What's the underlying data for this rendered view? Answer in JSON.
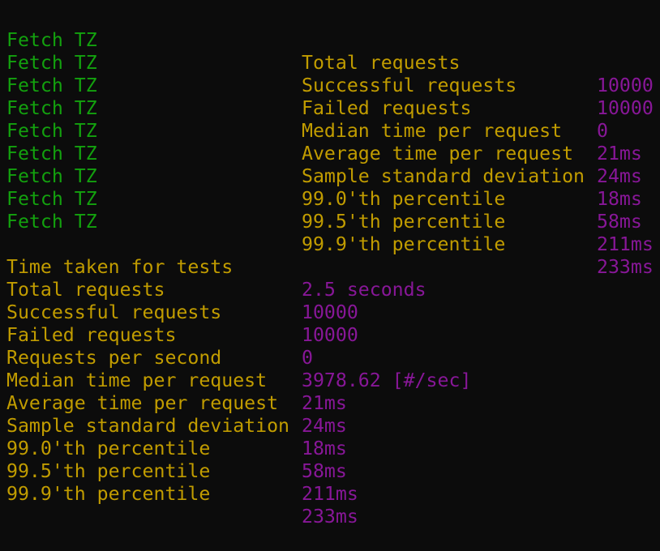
{
  "colors": {
    "background": "#0c0c0c",
    "name": "#13a10e",
    "label": "#c19c00",
    "value": "#881798"
  },
  "per_test": [
    {
      "name": "Fetch TZ",
      "label": "Total requests",
      "value": "10000"
    },
    {
      "name": "Fetch TZ",
      "label": "Successful requests",
      "value": "10000"
    },
    {
      "name": "Fetch TZ",
      "label": "Failed requests",
      "value": "0"
    },
    {
      "name": "Fetch TZ",
      "label": "Median time per request",
      "value": "21ms"
    },
    {
      "name": "Fetch TZ",
      "label": "Average time per request",
      "value": "24ms"
    },
    {
      "name": "Fetch TZ",
      "label": "Sample standard deviation",
      "value": "18ms"
    },
    {
      "name": "Fetch TZ",
      "label": "99.0'th percentile",
      "value": "58ms"
    },
    {
      "name": "Fetch TZ",
      "label": "99.5'th percentile",
      "value": "211ms"
    },
    {
      "name": "Fetch TZ",
      "label": "99.9'th percentile",
      "value": "233ms"
    }
  ],
  "summary": [
    {
      "label": "Time taken for tests",
      "value": "2.5 seconds"
    },
    {
      "label": "Total requests",
      "value": "10000"
    },
    {
      "label": "Successful requests",
      "value": "10000"
    },
    {
      "label": "Failed requests",
      "value": "0"
    },
    {
      "label": "Requests per second",
      "value": "3978.62 [#/sec]"
    },
    {
      "label": "Median time per request",
      "value": "21ms"
    },
    {
      "label": "Average time per request",
      "value": "24ms"
    },
    {
      "label": "Sample standard deviation",
      "value": "18ms"
    },
    {
      "label": "99.0'th percentile",
      "value": "58ms"
    },
    {
      "label": "99.5'th percentile",
      "value": "211ms"
    },
    {
      "label": "99.9'th percentile",
      "value": "233ms"
    }
  ]
}
